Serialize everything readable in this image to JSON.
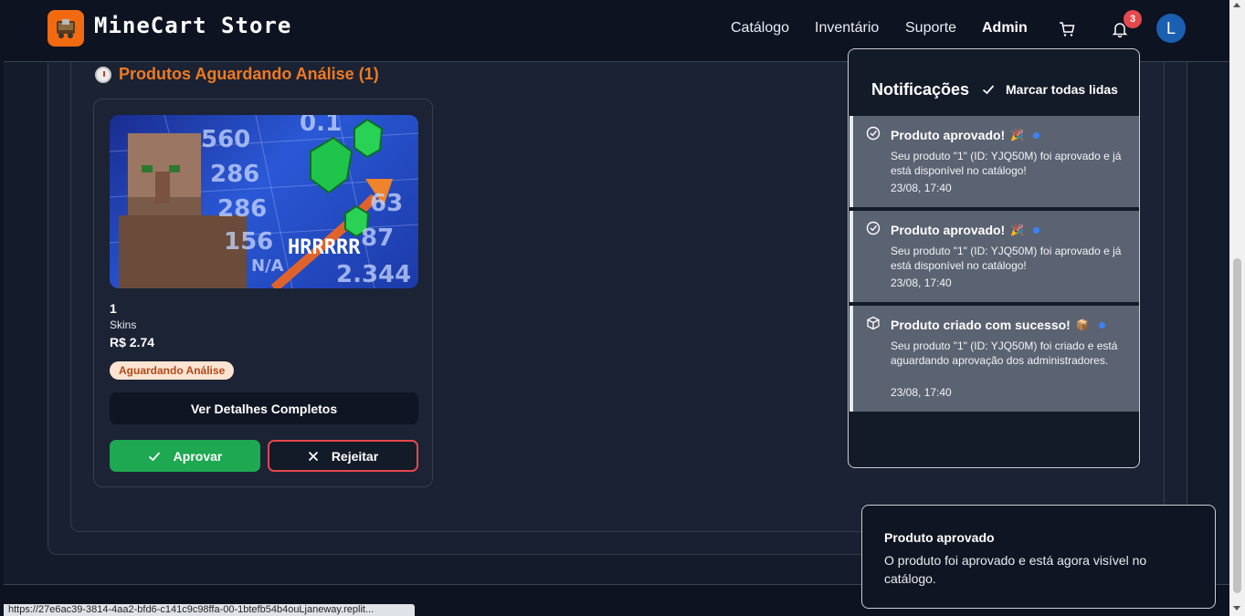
{
  "header": {
    "brand": "MineCart Store",
    "nav": [
      "Catálogo",
      "Inventário",
      "Suporte",
      "Admin"
    ],
    "notification_count": "3",
    "avatar_initial": "L",
    "icons": [
      "cart-icon",
      "bell-icon"
    ]
  },
  "section": {
    "title": "Produtos Aguardando Análise (1)"
  },
  "product": {
    "name": "1",
    "category": "Skins",
    "price": "R$ 2.74",
    "status": "Aguardando Análise",
    "details_label": "Ver Detalhes Completos",
    "approve_label": "Aprovar",
    "reject_label": "Rejeitar",
    "image_caption": "HRRRRR",
    "image_ticks": [
      "560",
      "286",
      "286",
      "156",
      "N/A",
      "63",
      "87",
      "2.344",
      "0.1"
    ]
  },
  "notifications": {
    "title": "Notificações",
    "mark_all_label": "Marcar todas lidas",
    "items": [
      {
        "icon": "check-circle-icon",
        "title": "Produto aprovado!",
        "emoji": "🎉",
        "body": "Seu produto \"1\" (ID: YJQ50M) foi aprovado e já está disponível no catálogo!",
        "time": "23/08, 17:40"
      },
      {
        "icon": "check-circle-icon",
        "title": "Produto aprovado!",
        "emoji": "🎉",
        "body": "Seu produto \"1\" (ID: YJQ50M) foi aprovado e já está disponível no catálogo!",
        "time": "23/08, 17:40"
      },
      {
        "icon": "package-icon",
        "title": "Produto criado com sucesso!",
        "emoji": "📦",
        "body": "Seu produto \"1\" (ID: YJQ50M) foi criado e está aguardando aprovação dos administradores.",
        "time": "23/08, 17:40"
      }
    ]
  },
  "toast": {
    "title": "Produto aprovado",
    "body": "O produto foi aprovado e está agora visível no catálogo."
  },
  "status_bar": {
    "url": "https://27e6ac39-3814-4aa2-bfd6-c141c9c98ffa-00-1btefb54b4ouLjaneway.replit..."
  },
  "colors": {
    "accent_orange": "#f26a10",
    "approve_green": "#1ea851",
    "reject_red": "#e5484d",
    "badge_red": "#e5484d",
    "unread_blue": "#3b82f6"
  }
}
